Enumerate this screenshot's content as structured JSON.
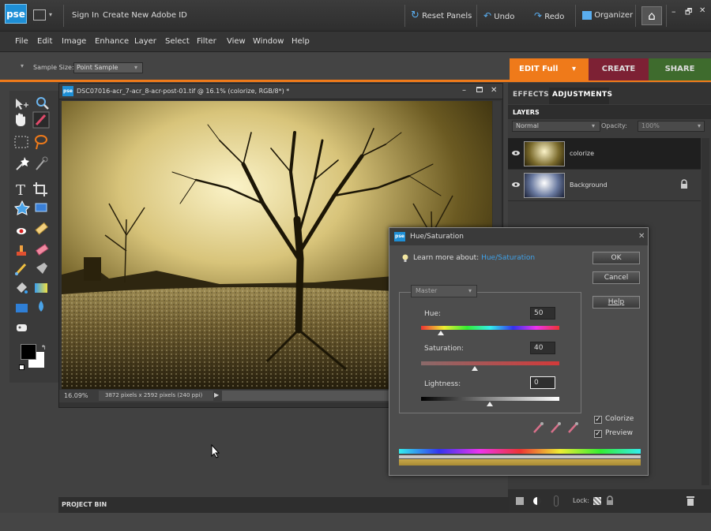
{
  "titlebar": {
    "logo": "pse",
    "sign_in": "Sign In",
    "create_id": "Create New Adobe ID",
    "reset_panels": "Reset Panels",
    "undo": "Undo",
    "redo": "Redo",
    "organizer": "Organizer",
    "window_controls": [
      "–",
      "🗗",
      "✕"
    ]
  },
  "menu": [
    "File",
    "Edit",
    "Image",
    "Enhance",
    "Layer",
    "Select",
    "Filter",
    "View",
    "Window",
    "Help"
  ],
  "options": {
    "sample_size_label": "Sample Size:",
    "sample_size_value": "Point Sample"
  },
  "modes": {
    "edit": "EDIT Full",
    "create": "CREATE",
    "share": "SHARE"
  },
  "document": {
    "title": "DSC07016-acr_7-acr_8-acr-post-01.tif @ 16.1% (colorize, RGB/8*) *",
    "zoom": "16.09%",
    "info": "3872 pixels x 2592 pixels (240 ppi)"
  },
  "panels": {
    "tab_effects": "EFFECTS",
    "tab_adjustments": "ADJUSTMENTS",
    "layers_title": "LAYERS",
    "blend_mode": "Normal",
    "opacity_label": "Opacity:",
    "opacity_value": "100%",
    "layers": [
      {
        "name": "colorize"
      },
      {
        "name": "Background"
      }
    ],
    "lock_label": "Lock:"
  },
  "project_bin": "PROJECT BIN",
  "dialog": {
    "title": "Hue/Saturation",
    "learn_prefix": "Learn more about:",
    "learn_link": "Hue/Saturation",
    "ok": "OK",
    "cancel": "Cancel",
    "help": "Help",
    "edit_target": "Master",
    "hue_label": "Hue:",
    "hue_value": "50",
    "saturation_label": "Saturation:",
    "saturation_value": "40",
    "lightness_label": "Lightness:",
    "lightness_value": "0",
    "colorize_label": "Colorize",
    "preview_label": "Preview",
    "colorize_checked": true,
    "preview_checked": true
  },
  "colors": {
    "accent_orange": "#ef7a1a",
    "create_red": "#7d2134",
    "share_green": "#3e6b2d",
    "link_blue": "#3fa1e8"
  }
}
